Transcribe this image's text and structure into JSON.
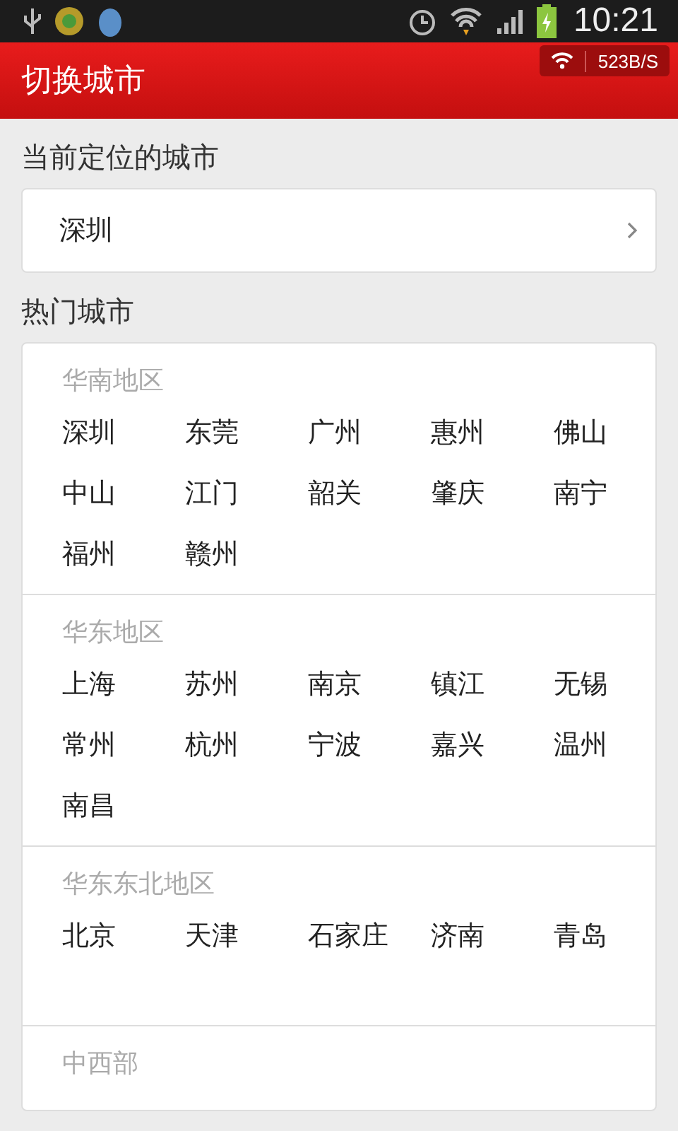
{
  "status_bar": {
    "time": "10:21"
  },
  "header": {
    "title": "切换城市",
    "net_speed": "523B/S"
  },
  "current_section": {
    "title": "当前定位的城市",
    "city": "深圳"
  },
  "hot_section": {
    "title": "热门城市",
    "regions": [
      {
        "name": "华南地区",
        "cities": [
          "深圳",
          "东莞",
          "广州",
          "惠州",
          "佛山",
          "中山",
          "江门",
          "韶关",
          "肇庆",
          "南宁",
          "福州",
          "赣州"
        ]
      },
      {
        "name": "华东地区",
        "cities": [
          "上海",
          "苏州",
          "南京",
          "镇江",
          "无锡",
          "常州",
          "杭州",
          "宁波",
          "嘉兴",
          "温州",
          "南昌"
        ]
      },
      {
        "name": "华东东北地区",
        "cities": [
          "北京",
          "天津",
          "石家庄",
          "济南",
          "青岛"
        ]
      },
      {
        "name": "中西部"
      }
    ]
  }
}
